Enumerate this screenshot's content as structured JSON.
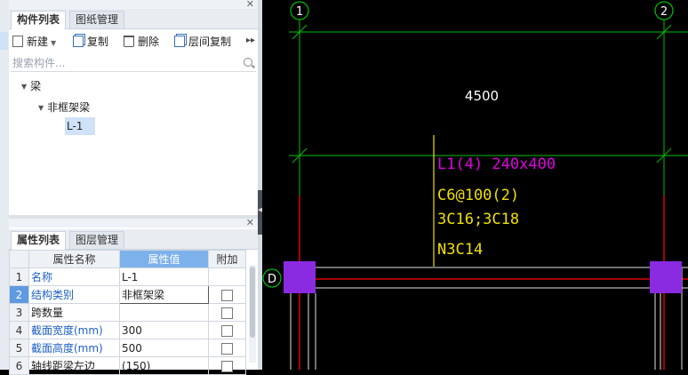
{
  "component_panel": {
    "tabs": [
      "构件列表",
      "图纸管理"
    ],
    "toolbar": {
      "new": "新建",
      "copy": "复制",
      "delete": "删除",
      "floor_copy": "层间复制",
      "more": "▸▸"
    },
    "search_placeholder": "搜索构件...",
    "tree": {
      "root": "梁",
      "child": "非框架梁",
      "leaf": "L-1"
    }
  },
  "property_panel": {
    "tabs": [
      "属性列表",
      "图层管理"
    ],
    "headers": [
      "属性名称",
      "属性值",
      "附加"
    ],
    "rows": [
      {
        "num": "1",
        "name": "名称",
        "value": "L-1"
      },
      {
        "num": "2",
        "name": "结构类别",
        "value": "非框架梁"
      },
      {
        "num": "3",
        "name": "跨数量",
        "value": ""
      },
      {
        "num": "4",
        "name": "截面宽度(mm)",
        "value": "300"
      },
      {
        "num": "5",
        "name": "截面高度(mm)",
        "value": "500"
      },
      {
        "num": "6",
        "name": "轴线距梁左边",
        "value": "(150)"
      }
    ]
  },
  "canvas": {
    "axis_top_left": "1",
    "axis_top_right": "2",
    "axis_left": "D",
    "dimension": "4500",
    "beam_label": "L1(4) 240x400",
    "stirrup": "C6@100(2)",
    "top_bars": "3C16;3C18",
    "side_bars": "N3C14",
    "colors": {
      "axis": "#00cc00",
      "beam_label": "#e000e0",
      "rebar_text": "#f0e000",
      "column": "#8a2be2",
      "grid_line": "#e0e0e0",
      "red_line": "#dd0000"
    }
  }
}
